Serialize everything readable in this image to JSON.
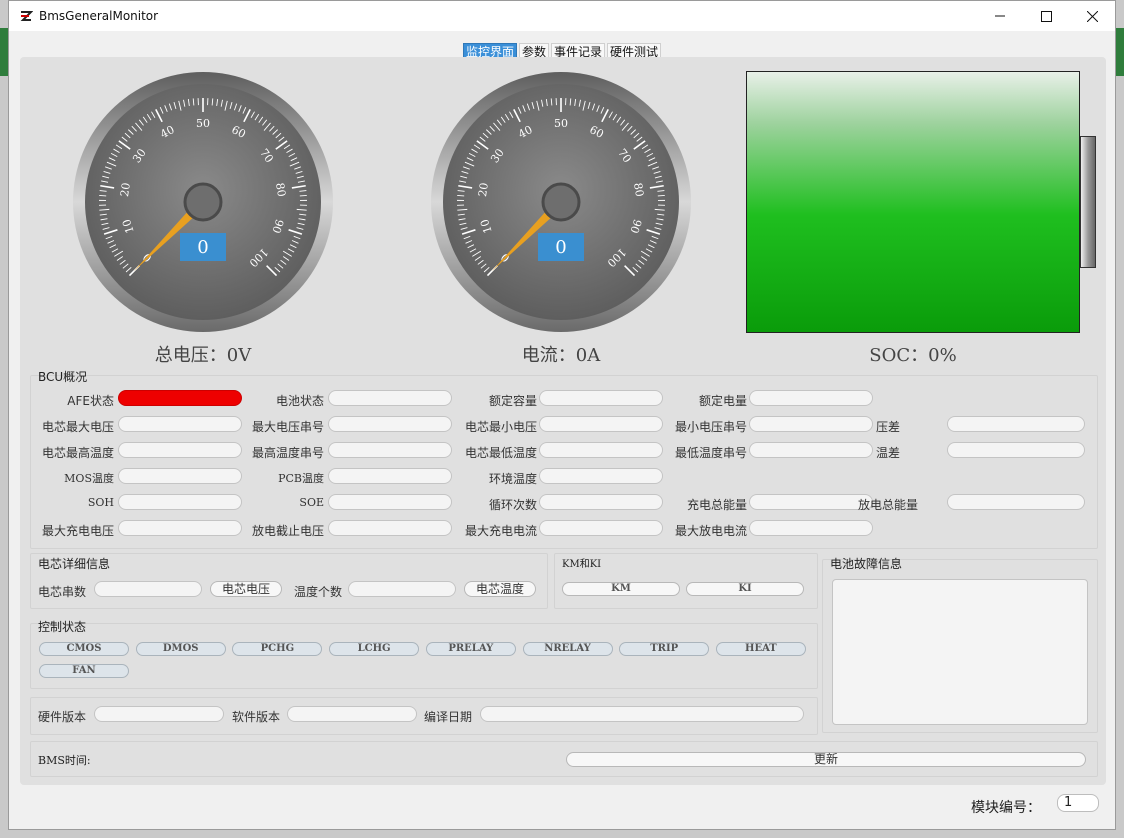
{
  "window": {
    "title": "BmsGeneralMonitor"
  },
  "tabs": [
    "监控界面",
    "参数",
    "事件记录",
    "硬件测试"
  ],
  "gauges": [
    {
      "ticks": [
        "0",
        "10",
        "20",
        "30",
        "40",
        "50",
        "60",
        "70",
        "80",
        "90",
        "100"
      ],
      "value": "0",
      "caption": "总电压：0V"
    },
    {
      "ticks": [
        "0",
        "10",
        "20",
        "30",
        "40",
        "50",
        "60",
        "70",
        "80",
        "90",
        "100"
      ],
      "value": "0",
      "caption": "电流：0A"
    }
  ],
  "soc": {
    "caption": "SOC：0%"
  },
  "bcu": {
    "title": "BCU概况",
    "rows": [
      [
        {
          "label": "AFE状态",
          "red": true
        },
        {
          "label": "电池状态"
        },
        {
          "label": "额定容量"
        },
        {
          "label": "额定电量"
        }
      ],
      [
        {
          "label": "电芯最大电压"
        },
        {
          "label": "最大电压串号"
        },
        {
          "label": "电芯最小电压"
        },
        {
          "label": "最小电压串号"
        },
        {
          "label": "压差"
        }
      ],
      [
        {
          "label": "电芯最高温度"
        },
        {
          "label": "最高温度串号"
        },
        {
          "label": "电芯最低温度"
        },
        {
          "label": "最低温度串号"
        },
        {
          "label": "温差"
        }
      ],
      [
        {
          "label": "MOS温度"
        },
        {
          "label": "PCB温度"
        },
        {
          "label": "环境温度"
        }
      ],
      [
        {
          "label": "SOH"
        },
        {
          "label": "SOE"
        },
        {
          "label": "循环次数"
        },
        {
          "label": "充电总能量"
        },
        {
          "label": "放电总能量"
        }
      ],
      [
        {
          "label": "最大充电电压"
        },
        {
          "label": "放电截止电压"
        },
        {
          "label": "最大充电电流"
        },
        {
          "label": "最大放电电流"
        }
      ]
    ]
  },
  "cell": {
    "title": "电芯详细信息",
    "count_label": "电芯串数",
    "voltage_btn": "电芯电压",
    "temp_count_label": "温度个数",
    "temp_btn": "电芯温度"
  },
  "kmki": {
    "title": "KM和KI",
    "km": "KM",
    "ki": "KI"
  },
  "fault": {
    "title": "电池故障信息"
  },
  "control": {
    "title": "控制状态",
    "items": [
      "CMOS",
      "DMOS",
      "PCHG",
      "LCHG",
      "PRELAY",
      "NRELAY",
      "TRIP",
      "HEAT",
      "FAN"
    ]
  },
  "version": {
    "hw_label": "硬件版本",
    "sw_label": "软件版本",
    "date_label": "编译日期"
  },
  "bms_time": {
    "label": "BMS时间:",
    "update_btn": "更新"
  },
  "module": {
    "label": "模块编号：",
    "value": "1"
  }
}
